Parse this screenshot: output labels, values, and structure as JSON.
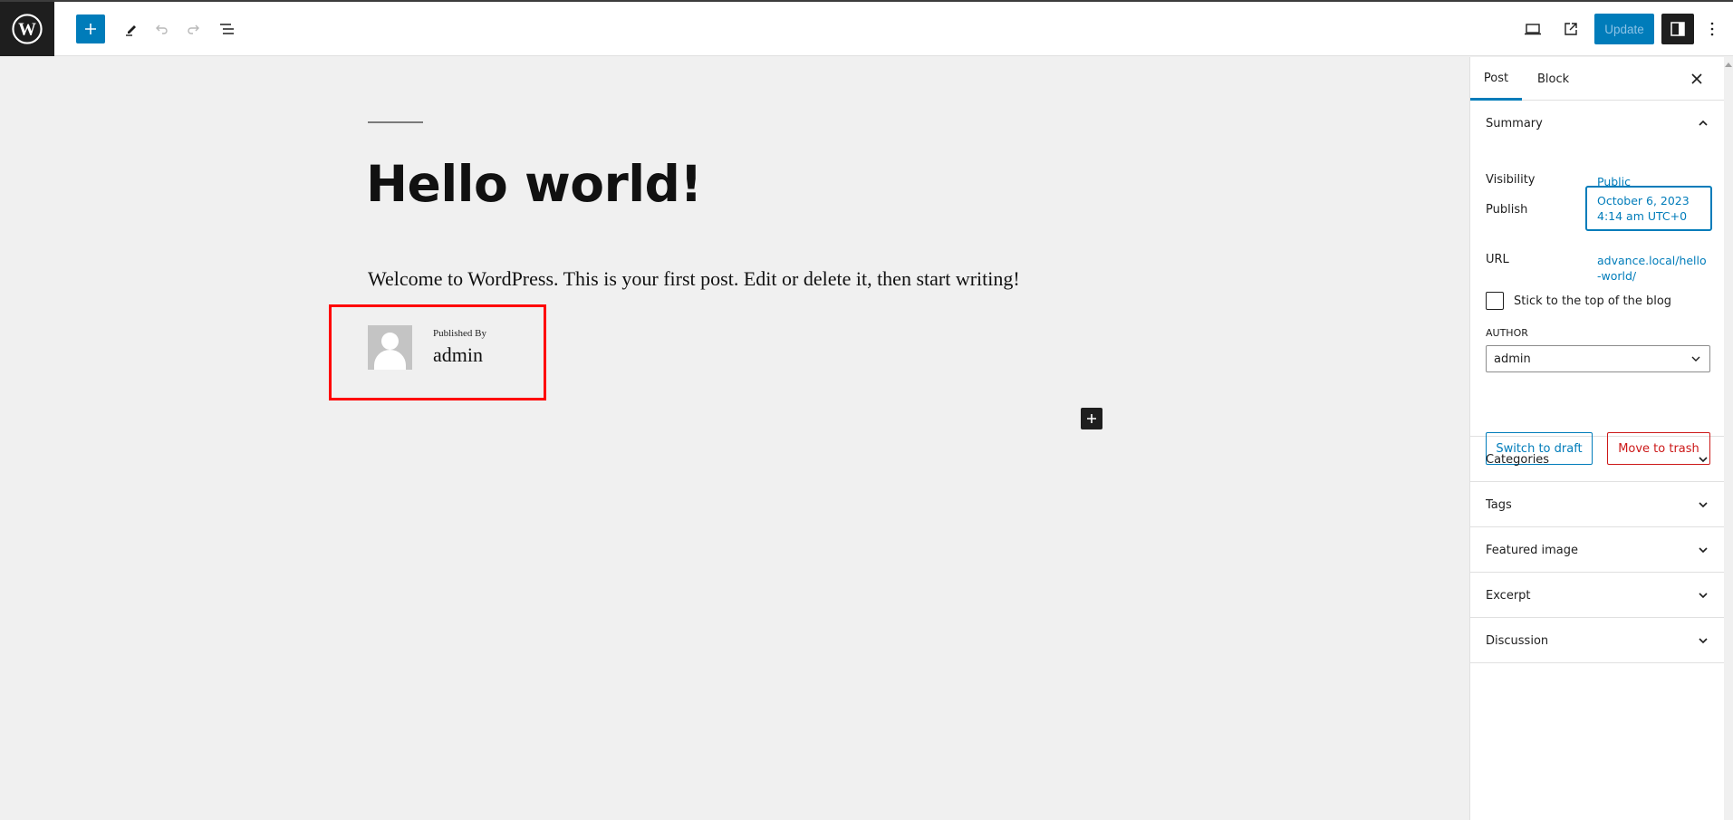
{
  "header": {
    "logo": "wordpress-logo",
    "toolbar_icons": [
      "plus-icon",
      "pencil-icon",
      "undo-icon",
      "redo-icon",
      "list-view-icon"
    ],
    "right_icons": [
      "preview-desktop-icon",
      "external-link-icon",
      "sidebar-toggle-icon",
      "more-vertical-icon"
    ],
    "update_label": "Update"
  },
  "editor": {
    "title": "Hello world!",
    "paragraph": "Welcome to WordPress. This is your first post. Edit or delete it, then start writing!",
    "author_block": {
      "label": "Published By",
      "name": "admin"
    },
    "highlight_color": "#ff0000"
  },
  "sidebar": {
    "tabs": [
      {
        "label": "Post",
        "active": true
      },
      {
        "label": "Block",
        "active": false
      }
    ],
    "summary": {
      "title": "Summary",
      "visibility_label": "Visibility",
      "visibility_value": "Public",
      "publish_label": "Publish",
      "publish_date": "October 6, 2023",
      "publish_time": "4:14 am UTC+0",
      "url_label": "URL",
      "url_line1": "advance.local/hello",
      "url_line2": "-world/",
      "sticky_label": "Stick to the top of the blog",
      "sticky_checked": false,
      "author_label": "AUTHOR",
      "author_value": "admin",
      "switch_draft_label": "Switch to draft",
      "trash_label": "Move to trash"
    },
    "panels": [
      {
        "title": "Categories"
      },
      {
        "title": "Tags"
      },
      {
        "title": "Featured image"
      },
      {
        "title": "Excerpt"
      },
      {
        "title": "Discussion"
      }
    ]
  },
  "colors": {
    "accent": "#007cba",
    "danger": "#cc1818",
    "dark": "#1e1e1e"
  }
}
